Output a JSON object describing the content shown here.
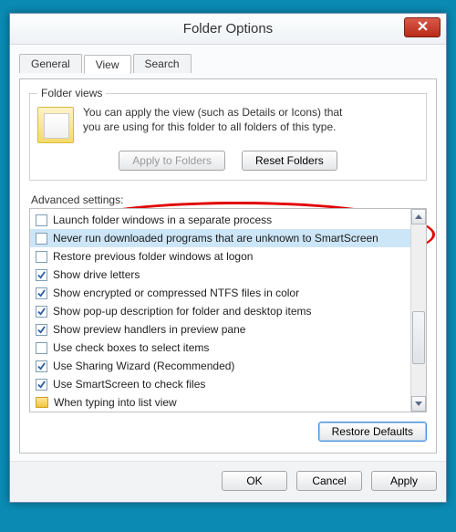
{
  "window": {
    "title": "Folder Options"
  },
  "tabs": {
    "general": "General",
    "view": "View",
    "search": "Search"
  },
  "folderViews": {
    "legend": "Folder views",
    "line1": "You can apply the view (such as Details or Icons) that",
    "line2": "you are using for this folder to all folders of this type.",
    "applyBtn": "Apply to Folders",
    "resetBtn": "Reset Folders"
  },
  "advanced": {
    "label": "Advanced settings:",
    "items": [
      {
        "checked": false,
        "label": "Launch folder windows in a separate process"
      },
      {
        "checked": false,
        "label": "Never run downloaded programs that are unknown to SmartScreen",
        "selected": true
      },
      {
        "checked": false,
        "label": "Restore previous folder windows at logon"
      },
      {
        "checked": true,
        "label": "Show drive letters"
      },
      {
        "checked": true,
        "label": "Show encrypted or compressed NTFS files in color"
      },
      {
        "checked": true,
        "label": "Show pop-up description for folder and desktop items"
      },
      {
        "checked": true,
        "label": "Show preview handlers in preview pane"
      },
      {
        "checked": false,
        "label": "Use check boxes to select items"
      },
      {
        "checked": true,
        "label": "Use Sharing Wizard (Recommended)"
      },
      {
        "checked": true,
        "label": "Use SmartScreen to check files"
      }
    ],
    "groupHeader": "When typing into list view"
  },
  "restoreDefaults": "Restore Defaults",
  "footer": {
    "ok": "OK",
    "cancel": "Cancel",
    "apply": "Apply"
  }
}
